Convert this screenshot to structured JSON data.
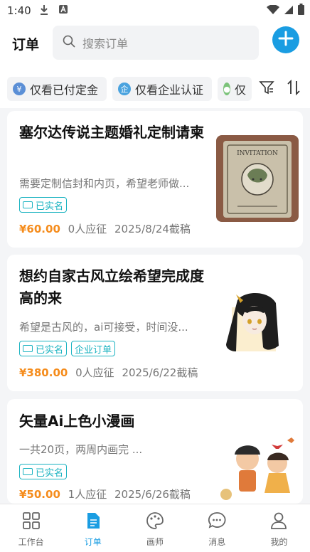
{
  "status_bar": {
    "time": "1:40"
  },
  "header": {
    "title": "订单",
    "search_placeholder": "搜索订单"
  },
  "filters": {
    "chips": [
      {
        "label": "仅看已付定金",
        "icon": "yen-icon",
        "color": "#5b8fd6"
      },
      {
        "label": "仅看企业认证",
        "icon": "enterprise-icon",
        "color": "#4aa3df"
      },
      {
        "label": "仅",
        "icon": "person-icon",
        "color": "#7cc37a"
      }
    ]
  },
  "orders": [
    {
      "title": "塞尔达传说主题婚礼定制请柬",
      "desc": "需要定制信封和内页，希望老师做...",
      "tags": [
        "已实名"
      ],
      "price": "¥60.00",
      "applicants": "0人应征",
      "deadline": "2025/8/24截稿",
      "thumb_text": "INVITATION"
    },
    {
      "title": "想约自家古风立绘希望完成度高的来",
      "desc": "希望是古风的，ai可接受，时间没...",
      "tags": [
        "已实名",
        "企业订单"
      ],
      "price": "¥380.00",
      "applicants": "0人应征",
      "deadline": "2025/6/22截稿"
    },
    {
      "title": "矢量Ai上色小漫画",
      "desc": "一共20页，两周内画完 ...",
      "tags": [
        "已实名"
      ],
      "price": "¥50.00",
      "applicants": "1人应征",
      "deadline": "2025/6/26截稿"
    }
  ],
  "tabbar": {
    "items": [
      {
        "label": "工作台",
        "icon": "grid-icon"
      },
      {
        "label": "订单",
        "icon": "document-icon",
        "active": true
      },
      {
        "label": "画师",
        "icon": "palette-icon"
      },
      {
        "label": "消息",
        "icon": "chat-icon"
      },
      {
        "label": "我的",
        "icon": "person-icon"
      }
    ]
  },
  "colors": {
    "accent": "#1a9de2",
    "price": "#f58c1c",
    "tag": "#1bb3c1"
  }
}
